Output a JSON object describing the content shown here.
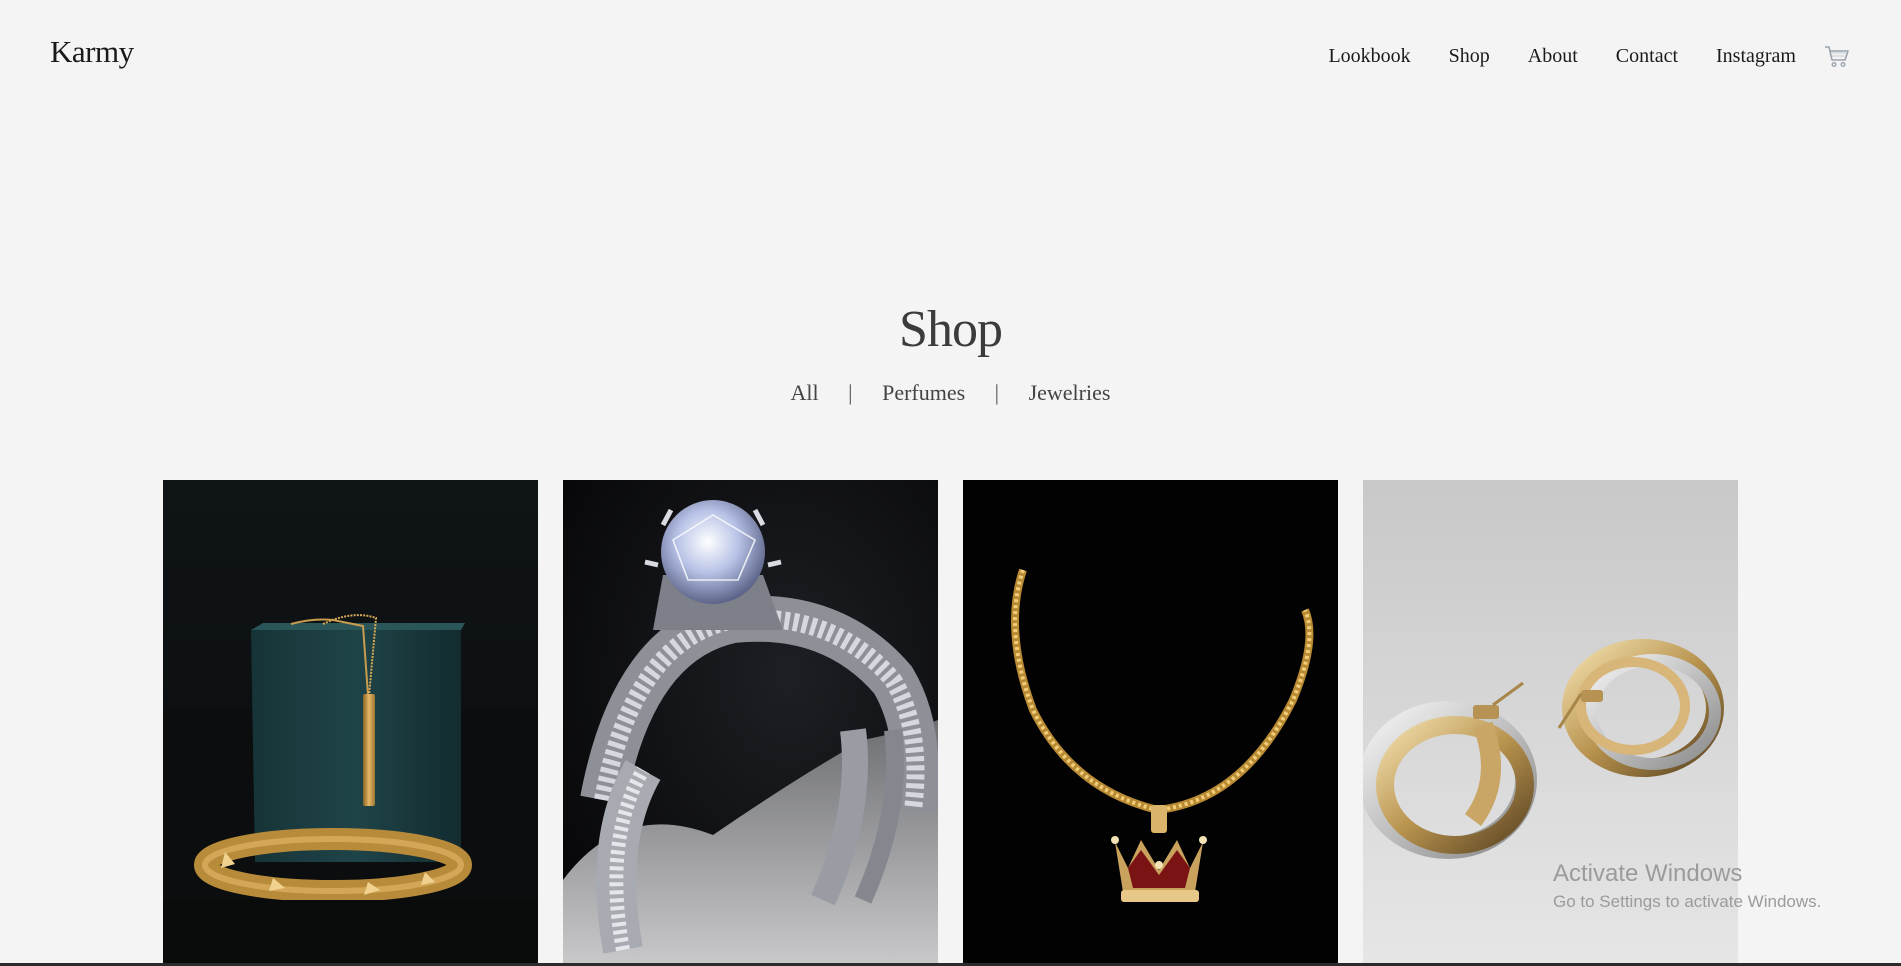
{
  "brand": {
    "name": "Karmy"
  },
  "nav": {
    "items": [
      {
        "label": "Lookbook"
      },
      {
        "label": "Shop"
      },
      {
        "label": "About"
      },
      {
        "label": "Contact"
      },
      {
        "label": "Instagram"
      }
    ],
    "cart_icon": "cart-icon"
  },
  "main": {
    "title": "Shop",
    "filters": [
      {
        "label": "All"
      },
      {
        "label": "Perfumes"
      },
      {
        "label": "Jewelries"
      }
    ],
    "separator": "|"
  },
  "products": [
    {
      "image": "gold-bar-necklace-and-bracelet-photo"
    },
    {
      "image": "diamond-ring-photo"
    },
    {
      "image": "gold-chain-crown-pendant-photo"
    },
    {
      "image": "gold-hoop-earrings-photo"
    }
  ],
  "overlay": {
    "title": "Activate Windows",
    "subtitle": "Go to Settings to activate Windows."
  },
  "colors": {
    "background": "#f4f4f4",
    "text": "#1a1a1a",
    "title": "#3b3b3b",
    "watermark": "#9b9b9b"
  }
}
